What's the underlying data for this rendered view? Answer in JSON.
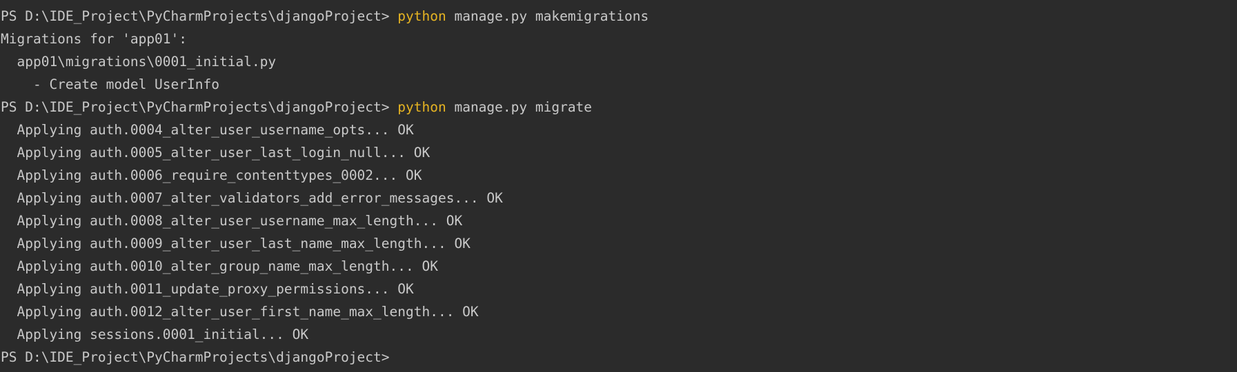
{
  "terminal": {
    "lines": [
      {
        "type": "command",
        "prompt": "PS D:\\IDE_Project\\PyCharmProjects\\djangoProject> ",
        "cmd": "python",
        "args": " manage.py makemigrations"
      },
      {
        "type": "output",
        "text": "Migrations for 'app01':"
      },
      {
        "type": "output",
        "text": "  app01\\migrations\\0001_initial.py"
      },
      {
        "type": "output",
        "text": "    - Create model UserInfo"
      },
      {
        "type": "command",
        "prompt": "PS D:\\IDE_Project\\PyCharmProjects\\djangoProject> ",
        "cmd": "python",
        "args": " manage.py migrate"
      },
      {
        "type": "output",
        "text": "  Applying auth.0004_alter_user_username_opts... OK"
      },
      {
        "type": "output",
        "text": "  Applying auth.0005_alter_user_last_login_null... OK"
      },
      {
        "type": "output",
        "text": "  Applying auth.0006_require_contenttypes_0002... OK"
      },
      {
        "type": "output",
        "text": "  Applying auth.0007_alter_validators_add_error_messages... OK"
      },
      {
        "type": "output",
        "text": "  Applying auth.0008_alter_user_username_max_length... OK"
      },
      {
        "type": "output",
        "text": "  Applying auth.0009_alter_user_last_name_max_length... OK"
      },
      {
        "type": "output",
        "text": "  Applying auth.0010_alter_group_name_max_length... OK"
      },
      {
        "type": "output",
        "text": "  Applying auth.0011_update_proxy_permissions... OK"
      },
      {
        "type": "output",
        "text": "  Applying auth.0012_alter_user_first_name_max_length... OK"
      },
      {
        "type": "output",
        "text": "  Applying sessions.0001_initial... OK"
      },
      {
        "type": "command",
        "prompt": "PS D:\\IDE_Project\\PyCharmProjects\\djangoProject> ",
        "cmd": "",
        "args": ""
      }
    ]
  },
  "colors": {
    "background": "#2b2b2b",
    "text": "#c9c9c9",
    "command": "#e6b422"
  }
}
